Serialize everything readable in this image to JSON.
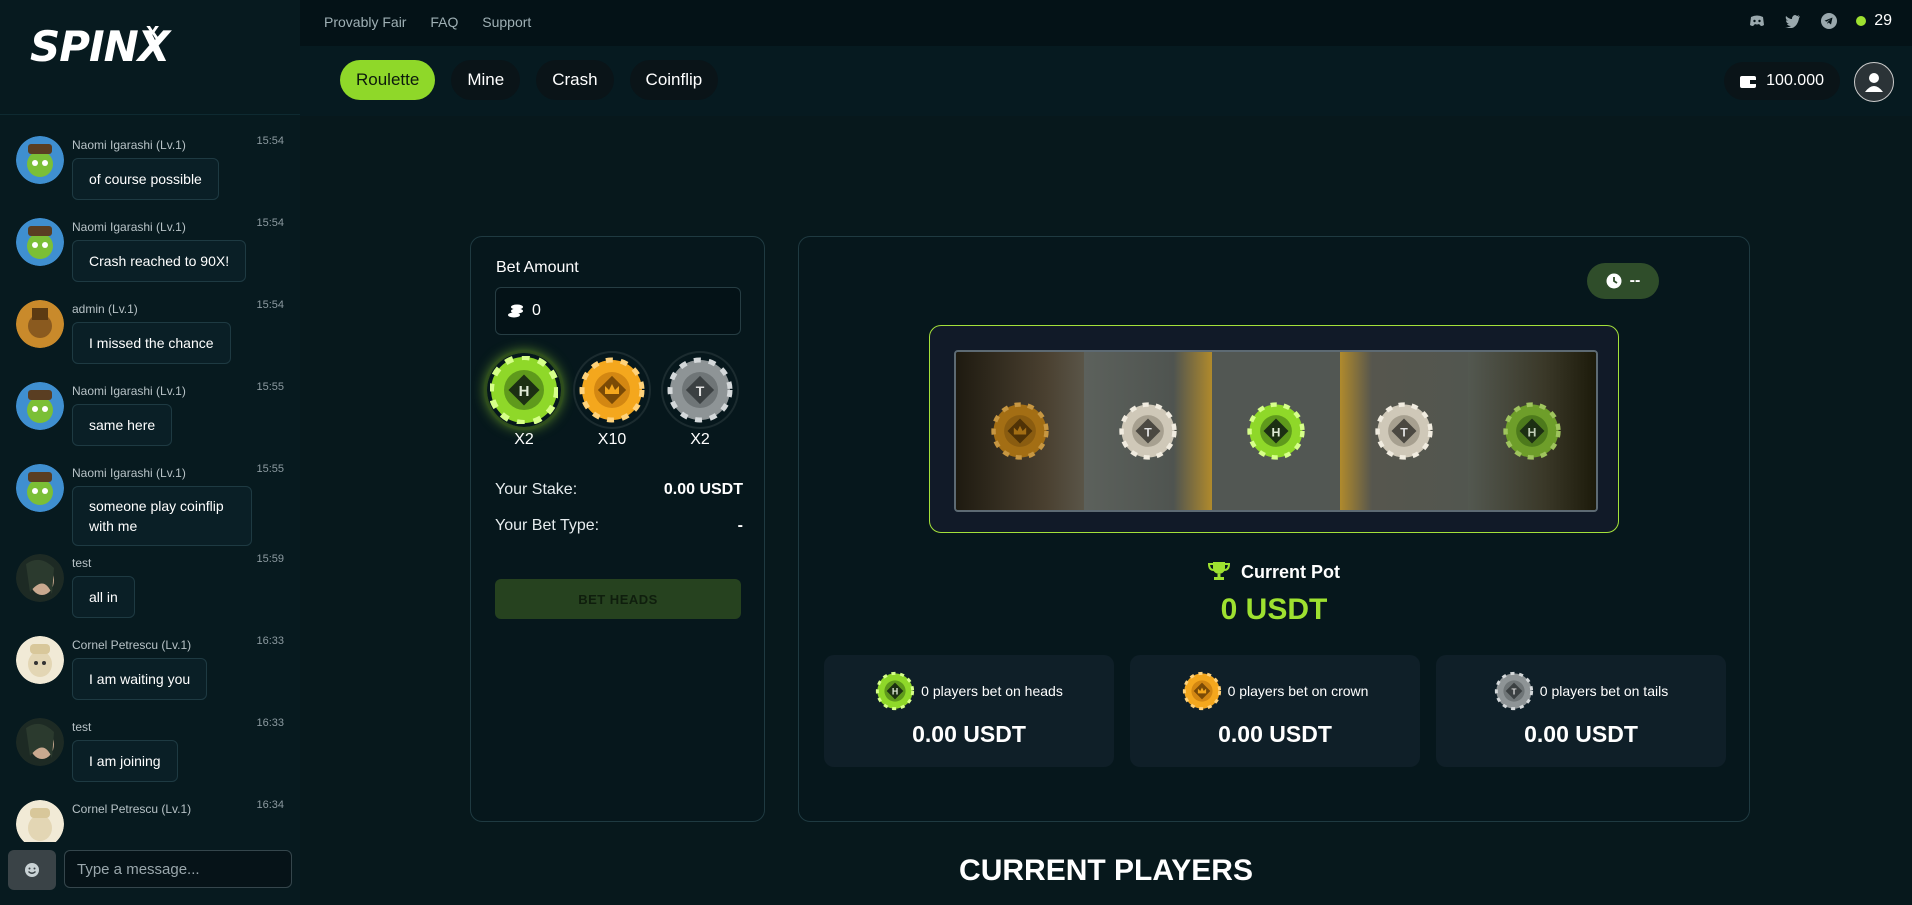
{
  "brand": {
    "name": "SPINX",
    "mark": "x"
  },
  "topbar": {
    "links": [
      "Provably Fair",
      "FAQ",
      "Support"
    ],
    "social_icons": [
      "discord-icon",
      "twitter-icon",
      "telegram-icon"
    ],
    "online_count": "29",
    "online_color": "#9ee130"
  },
  "nav": {
    "tabs": [
      {
        "label": "Roulette",
        "active": true
      },
      {
        "label": "Mine",
        "active": false
      },
      {
        "label": "Crash",
        "active": false
      },
      {
        "label": "Coinflip",
        "active": false
      }
    ],
    "balance": "100.000"
  },
  "chat": {
    "messages": [
      {
        "name": "Naomi Igarashi (Lv.1)",
        "time": "15:54",
        "text": "of course possible"
      },
      {
        "name": "Naomi Igarashi (Lv.1)",
        "time": "15:54",
        "text": "Crash reached to 90X!"
      },
      {
        "name": "admin (Lv.1)",
        "time": "15:54",
        "text": "I missed the chance"
      },
      {
        "name": "Naomi Igarashi (Lv.1)",
        "time": "15:55",
        "text": "same here"
      },
      {
        "name": "Naomi Igarashi (Lv.1)",
        "time": "15:55",
        "text": "someone play coinflip with me"
      },
      {
        "name": "test",
        "time": "15:59",
        "text": "all in"
      },
      {
        "name": "Cornel Petrescu (Lv.1)",
        "time": "16:33",
        "text": "I am waiting you"
      },
      {
        "name": "test",
        "time": "16:33",
        "text": "I am joining"
      },
      {
        "name": "Cornel Petrescu (Lv.1)",
        "time": "16:34",
        "text": ""
      }
    ],
    "input_placeholder": "Type a message..."
  },
  "bet": {
    "label": "Bet Amount",
    "amount": "0",
    "options": [
      {
        "letter": "H",
        "mult": "X2",
        "color": "#9ee130"
      },
      {
        "letter": "",
        "mult": "X10",
        "color": "#f5a623"
      },
      {
        "letter": "T",
        "mult": "X2",
        "color": "#c8c8c8"
      }
    ],
    "stake_label": "Your Stake:",
    "stake_value": "0.00 USDT",
    "type_label": "Your Bet Type:",
    "type_value": "-",
    "button": "BET HEADS"
  },
  "game": {
    "timer": "--",
    "pot_label": "Current Pot",
    "pot_value": "0 USDT",
    "cards": [
      {
        "label": "0 players bet on heads",
        "amount": "0.00 USDT",
        "type": "heads"
      },
      {
        "label": "0 players bet on crown",
        "amount": "0.00 USDT",
        "type": "crown"
      },
      {
        "label": "0 players bet on tails",
        "amount": "0.00 USDT",
        "type": "tails"
      }
    ],
    "reel": [
      "crown",
      "tails",
      "heads",
      "tails",
      "heads"
    ]
  },
  "section": {
    "title": "CURRENT PLAYERS"
  }
}
